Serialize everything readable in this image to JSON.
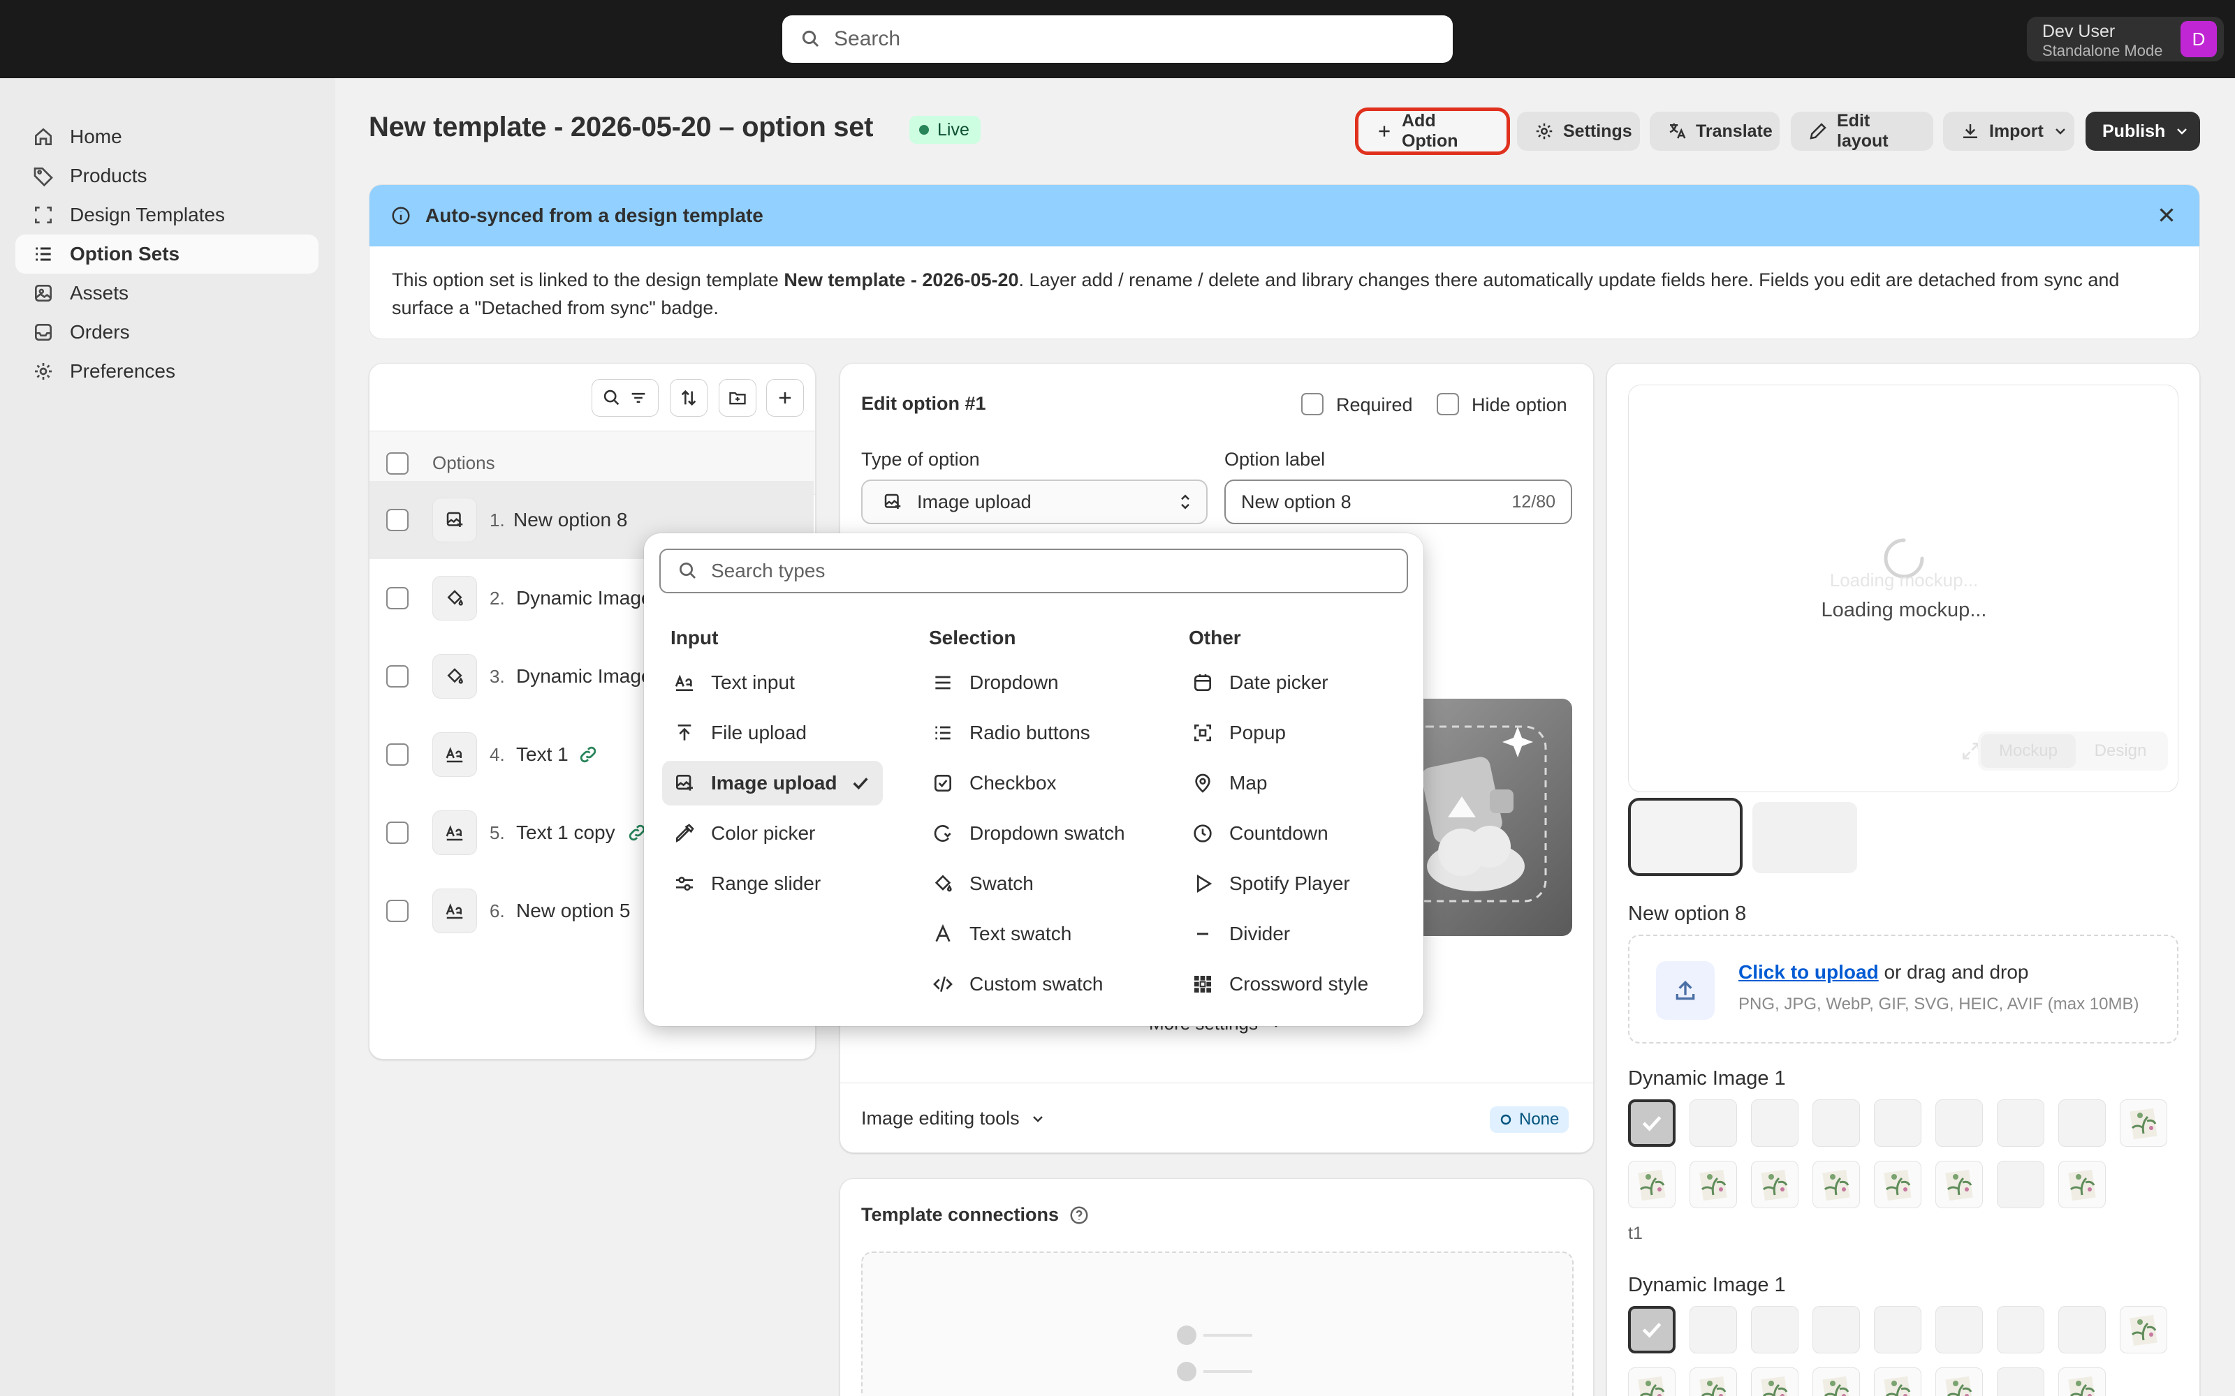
{
  "topbar": {
    "search_placeholder": "Search",
    "user_name": "Dev User",
    "user_mode": "Standalone Mode",
    "avatar_initial": "D"
  },
  "sidebar": {
    "items": [
      {
        "label": "Home",
        "icon": "home-icon"
      },
      {
        "label": "Products",
        "icon": "tag-icon"
      },
      {
        "label": "Design Templates",
        "icon": "frame-icon"
      },
      {
        "label": "Option Sets",
        "icon": "list-icon",
        "active": true
      },
      {
        "label": "Assets",
        "icon": "image-icon"
      },
      {
        "label": "Orders",
        "icon": "inbox-icon"
      },
      {
        "label": "Preferences",
        "icon": "gear-icon"
      }
    ]
  },
  "header": {
    "title": "New template - 2026-05-20 – option set",
    "status": "Live",
    "buttons": {
      "add_option": "Add Option",
      "settings": "Settings",
      "translate": "Translate",
      "edit_layout": "Edit layout",
      "import": "Import",
      "publish": "Publish"
    }
  },
  "banner": {
    "title": "Auto-synced from a design template",
    "body_prefix": "This option set is linked to the design template ",
    "body_bold": "New template - 2026-05-20",
    "body_suffix": ". Layer add / rename / delete and library changes there automatically update fields here. Fields you edit are detached from sync and surface a \"Detached from sync\" badge."
  },
  "options_list": {
    "header": "Options",
    "items": [
      {
        "num": "1.",
        "label": "New option 8",
        "icon": "image-upload-icon"
      },
      {
        "num": "2.",
        "label": "Dynamic Image",
        "icon": "swatch-icon"
      },
      {
        "num": "3.",
        "label": "Dynamic Image",
        "icon": "swatch-icon"
      },
      {
        "num": "4.",
        "label": "Text 1",
        "icon": "text-icon",
        "linked": true
      },
      {
        "num": "5.",
        "label": "Text 1 copy",
        "icon": "text-icon",
        "linked": true
      },
      {
        "num": "6.",
        "label": "New option 5",
        "icon": "text-icon"
      }
    ]
  },
  "edit": {
    "title": "Edit option #1",
    "required_label": "Required",
    "hide_label": "Hide option",
    "type_label": "Type of option",
    "type_value": "Image upload",
    "option_label_label": "Option label",
    "option_label_value": "New option 8",
    "char_count": "12/80",
    "more_settings": "More settings",
    "image_tools": "Image editing tools",
    "image_tools_badge": "None"
  },
  "connections": {
    "title": "Template connections"
  },
  "type_picker": {
    "search_placeholder": "Search types",
    "columns": [
      {
        "heading": "Input",
        "items": [
          {
            "label": "Text input",
            "icon": "text-input-icon"
          },
          {
            "label": "File upload",
            "icon": "upload-icon"
          },
          {
            "label": "Image upload",
            "icon": "image-upload-icon",
            "selected": true
          },
          {
            "label": "Color picker",
            "icon": "eyedropper-icon"
          },
          {
            "label": "Range slider",
            "icon": "slider-icon"
          }
        ]
      },
      {
        "heading": "Selection",
        "items": [
          {
            "label": "Dropdown",
            "icon": "lines-icon"
          },
          {
            "label": "Radio buttons",
            "icon": "radio-list-icon"
          },
          {
            "label": "Checkbox",
            "icon": "checkbox-icon"
          },
          {
            "label": "Dropdown swatch",
            "icon": "dropdown-swatch-icon"
          },
          {
            "label": "Swatch",
            "icon": "paint-bucket-icon"
          },
          {
            "label": "Text swatch",
            "icon": "letter-a-icon"
          },
          {
            "label": "Custom swatch",
            "icon": "code-icon"
          }
        ]
      },
      {
        "heading": "Other",
        "items": [
          {
            "label": "Date picker",
            "icon": "calendar-icon"
          },
          {
            "label": "Popup",
            "icon": "popup-icon"
          },
          {
            "label": "Map",
            "icon": "map-pin-icon"
          },
          {
            "label": "Countdown",
            "icon": "clock-icon"
          },
          {
            "label": "Spotify Player",
            "icon": "play-icon"
          },
          {
            "label": "Divider",
            "icon": "minus-icon"
          },
          {
            "label": "Crossword style",
            "icon": "grid-icon"
          }
        ]
      }
    ]
  },
  "preview": {
    "loading_text": "Loading mockup...",
    "loading_ghost": "Loading mockup...",
    "tab_mockup": "Mockup",
    "tab_design": "Design",
    "option_title": "New option 8",
    "upload_link": "Click to upload",
    "upload_rest": " or drag and drop",
    "upload_formats": "PNG, JPG, WebP, GIF, SVG, HEIC, AVIF (max 10MB)",
    "dynamic_title_1": "Dynamic Image 1",
    "caption": "t1",
    "dynamic_title_2": "Dynamic Image 1"
  },
  "colors": {
    "accent": "#e0311e",
    "banner": "#91d0ff",
    "live_bg": "#cdfee1",
    "publish": "#303030",
    "link": "#005bd3"
  }
}
